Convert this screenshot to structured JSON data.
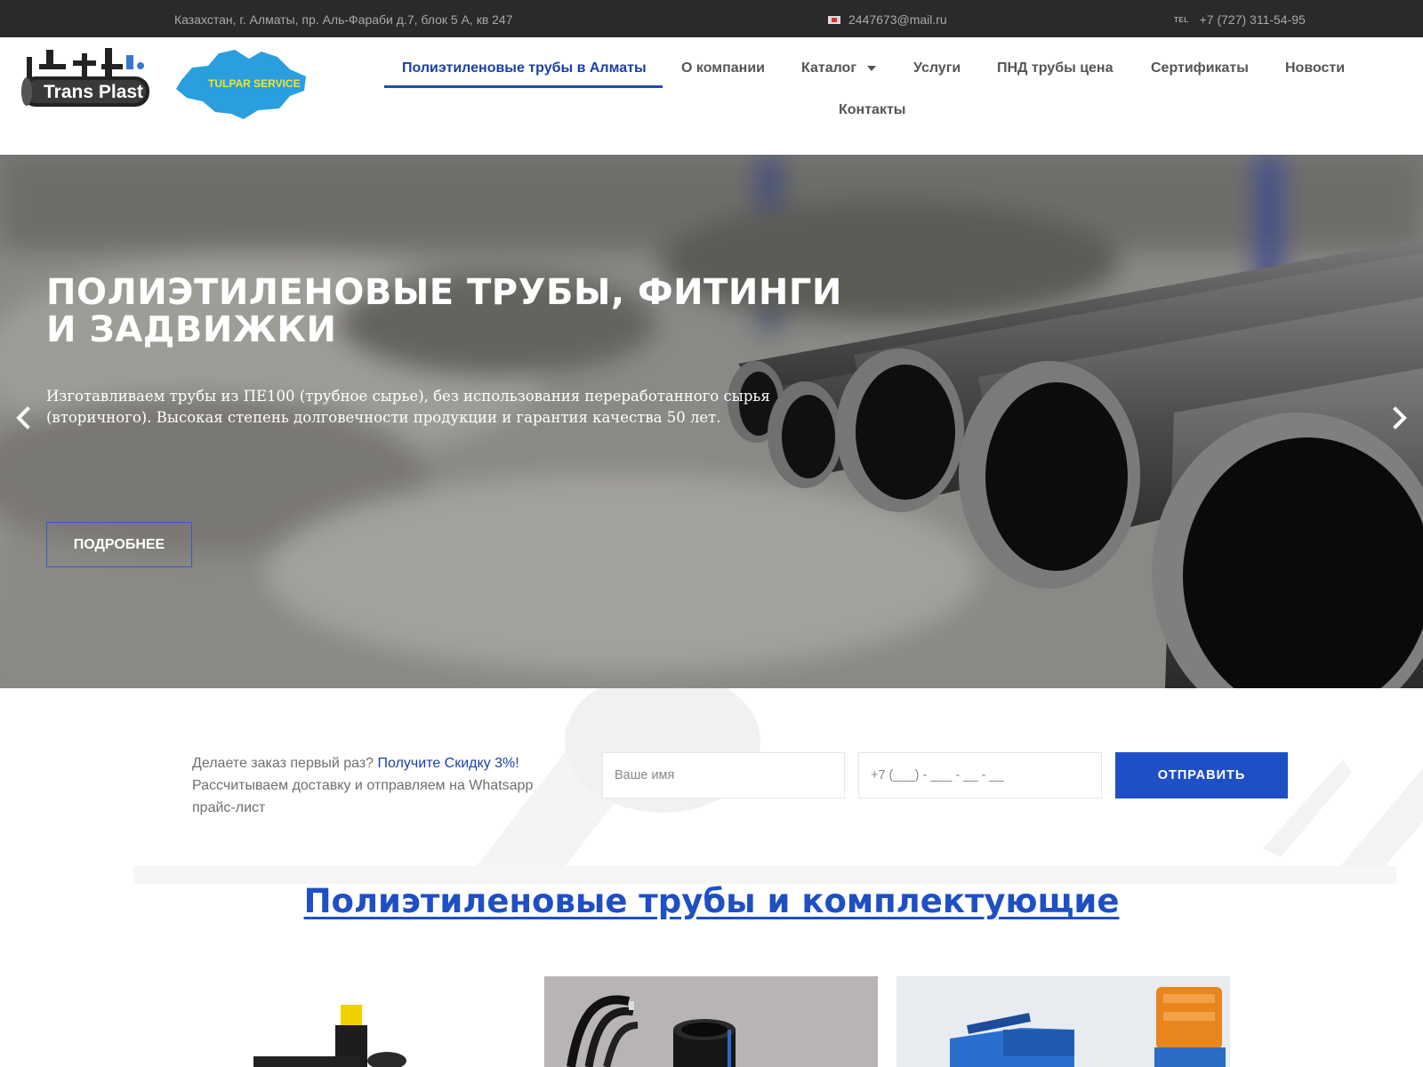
{
  "topbar": {
    "address": "Казахстан, г. Алматы, пр. Аль-Фараби д.7, блок 5 А, кв 247",
    "email": "2447673@mail.ru",
    "tel_label": "TEL",
    "phone": "+7 (727) 311-54-95"
  },
  "header": {
    "logo1_text": "Trans Plast",
    "logo2_text": "TULPAR SERVICE",
    "nav": [
      {
        "label": "Полиэтиленовые трубы в Алматы",
        "active": true
      },
      {
        "label": "О компании"
      },
      {
        "label": "Каталог",
        "has_dropdown": true
      },
      {
        "label": "Услуги"
      },
      {
        "label": "ПНД трубы цена"
      },
      {
        "label": "Сертификаты"
      },
      {
        "label": "Новости"
      },
      {
        "label": "Контакты"
      }
    ]
  },
  "hero": {
    "title": "ПОЛИЭТИЛЕНОВЫЕ ТРУБЫ, ФИТИНГИ И ЗАДВИЖКИ",
    "text": "Изготавливаем трубы из ПЕ100 (трубное сырье), без использования переработанного сырья (вторичного). Высокая степень долговечности продукции и гарантия качества 50 лет.",
    "button": "ПОДРОБНЕЕ",
    "prev_icon": "chevron-left-icon",
    "next_icon": "chevron-right-icon"
  },
  "lead": {
    "text_before": "Делаете заказ первый раз? ",
    "text_highlight": "Получите Скидку 3%!",
    "text_after": " Рассчитываем доставку и отправляем на Whatsapp прайс-лист",
    "name_placeholder": "Ваше имя",
    "phone_placeholder": "+7 (___) - ___ - __ - __",
    "submit": "ОТПРАВИТЬ"
  },
  "products": {
    "title": "Полиэтиленовые трубы и комплектующие"
  },
  "colors": {
    "accent": "#1f4fc4",
    "topbar_bg": "#2a2a2a",
    "nav_active": "#1a3fa8"
  }
}
